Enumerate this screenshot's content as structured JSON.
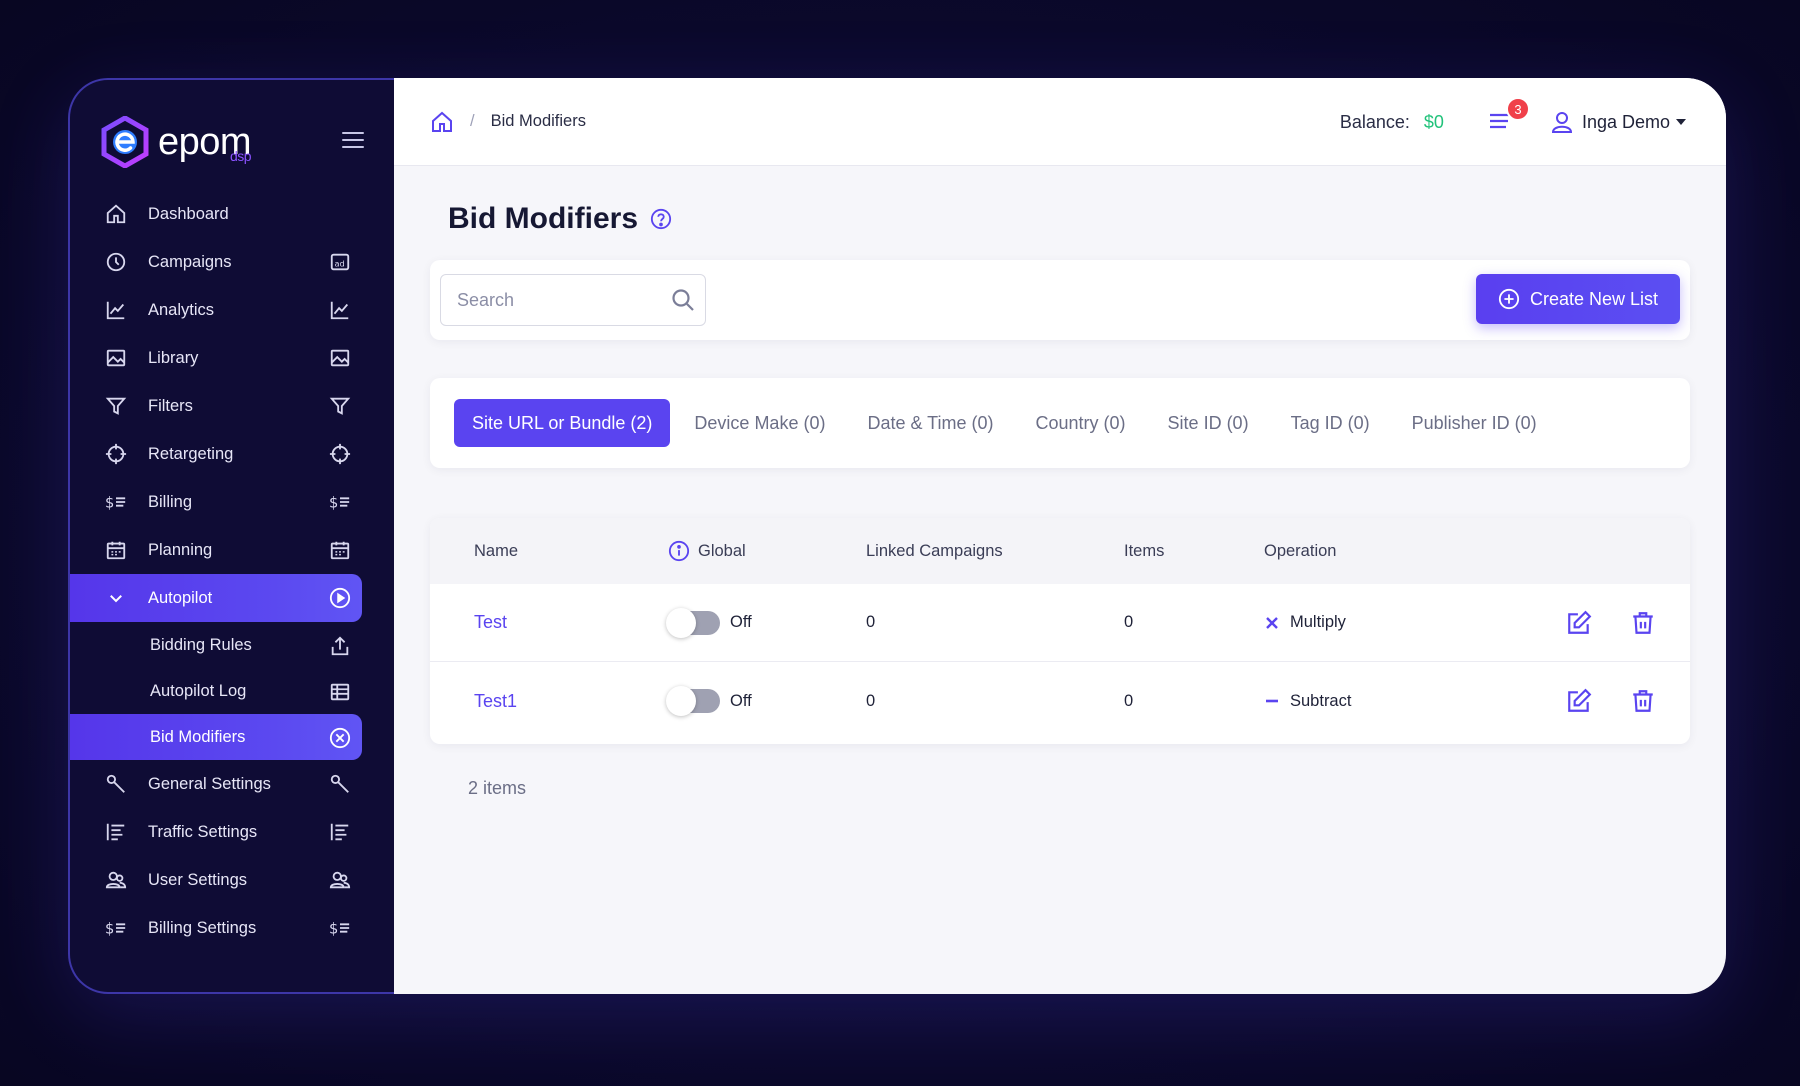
{
  "brand": {
    "name": "epom",
    "sub": "dsp"
  },
  "sidebar": {
    "items": [
      {
        "label": "Dashboard",
        "icon": "home-icon"
      },
      {
        "label": "Campaigns",
        "icon": "campaigns-icon",
        "right_icon": "ad-icon"
      },
      {
        "label": "Analytics",
        "icon": "chart-icon",
        "right_icon": "chart-icon"
      },
      {
        "label": "Library",
        "icon": "image-icon",
        "right_icon": "image-icon"
      },
      {
        "label": "Filters",
        "icon": "filter-icon",
        "right_icon": "filter-icon"
      },
      {
        "label": "Retargeting",
        "icon": "crosshair-icon",
        "right_icon": "crosshair-icon"
      },
      {
        "label": "Billing",
        "icon": "dollar-list-icon",
        "right_icon": "dollar-list-icon"
      },
      {
        "label": "Planning",
        "icon": "calendar-icon",
        "right_icon": "calendar-icon"
      },
      {
        "label": "Autopilot",
        "icon": "chevron-down-icon",
        "right_icon": "play-circle-icon"
      }
    ],
    "autopilot_sub": [
      {
        "label": "Bidding Rules",
        "right_icon": "upload-icon"
      },
      {
        "label": "Autopilot Log",
        "right_icon": "table-icon"
      },
      {
        "label": "Bid Modifiers",
        "right_icon": "x-circle-icon"
      }
    ],
    "bottom_items": [
      {
        "label": "General Settings",
        "icon": "wrench-icon",
        "right_icon": "wrench-icon"
      },
      {
        "label": "Traffic Settings",
        "icon": "align-left-icon",
        "right_icon": "align-left-icon"
      },
      {
        "label": "User Settings",
        "icon": "users-icon",
        "right_icon": "users-icon"
      },
      {
        "label": "Billing Settings",
        "icon": "dollar-list-icon",
        "right_icon": "dollar-list-icon"
      }
    ]
  },
  "header": {
    "breadcrumb_sep": "/",
    "breadcrumb_current": "Bid Modifiers",
    "balance_label": "Balance:",
    "balance_value": "$0",
    "notification_count": "3",
    "user_name": "Inga Demo"
  },
  "page": {
    "title": "Bid Modifiers",
    "search_placeholder": "Search",
    "create_button": "Create New List",
    "tabs": [
      {
        "label": "Site URL or Bundle (2)",
        "active": true
      },
      {
        "label": "Device Make (0)"
      },
      {
        "label": "Date & Time (0)"
      },
      {
        "label": "Country (0)"
      },
      {
        "label": "Site ID (0)"
      },
      {
        "label": "Tag ID (0)"
      },
      {
        "label": "Publisher ID (0)"
      }
    ],
    "columns": {
      "name": "Name",
      "global": "Global",
      "linked": "Linked Campaigns",
      "items": "Items",
      "operation": "Operation"
    },
    "rows": [
      {
        "name": "Test",
        "global": "Off",
        "linked": "0",
        "items": "0",
        "operation": "Multiply",
        "op_icon": "multiply-icon"
      },
      {
        "name": "Test1",
        "global": "Off",
        "linked": "0",
        "items": "0",
        "operation": "Subtract",
        "op_icon": "minus-icon"
      }
    ],
    "items_count": "2 items"
  },
  "colors": {
    "accent": "#5a44f0",
    "sidebar_bg": "#0f0c35",
    "balance": "#21c27a",
    "badge": "#f0404a"
  }
}
